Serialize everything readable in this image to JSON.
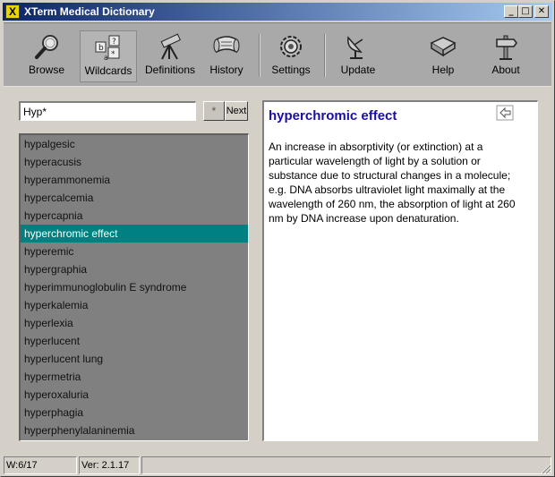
{
  "window": {
    "app_icon_letter": "X",
    "title": "XTerm Medical Dictionary",
    "controls": {
      "minimize": "_",
      "maximize": "□",
      "close": "✕"
    }
  },
  "toolbar": {
    "buttons": [
      {
        "label": "Browse",
        "icon": "magnifier-icon"
      },
      {
        "label": "Wildcards",
        "icon": "wildcards-icon"
      },
      {
        "label": "Definitions",
        "icon": "telescope-icon"
      },
      {
        "label": "History",
        "icon": "scroll-icon"
      },
      {
        "label": "Settings",
        "icon": "gear-icon"
      },
      {
        "label": "Update",
        "icon": "satellite-dish-icon"
      },
      {
        "label": "Help",
        "icon": "book-icon"
      },
      {
        "label": "About",
        "icon": "signpost-icon"
      }
    ]
  },
  "search": {
    "value": "Hyp*",
    "wildcard_label": "*",
    "next_label": "Next"
  },
  "word_list": {
    "items": [
      "hypalgesic",
      "hyperacusis",
      "hyperammonemia",
      "hypercalcemia",
      "hypercapnia",
      "hyperchromic effect",
      "hyperemic",
      "hypergraphia",
      "hyperimmunoglobulin E syndrome",
      "hyperkalemia",
      "hyperlexia",
      "hyperlucent",
      "hyperlucent lung",
      "hypermetria",
      "hyperoxaluria",
      "hyperphagia",
      "hyperphenylalaninemia"
    ],
    "selected_index": 5
  },
  "definition": {
    "term": "hyperchromic effect",
    "text": "An increase in absorptivity (or extinction) at a particular wavelength of light by a solution or substance due to structural changes in a molecule; e.g. DNA absorbs ultraviolet light maximally at the wavelength of 260 nm, the absorption of light at 260 nm by DNA increase upon denaturation."
  },
  "statusbar": {
    "word_count": "W:6/17",
    "version": "Ver: 2.1.17",
    "message": ""
  },
  "colors": {
    "title_start": "#0a246a",
    "title_end": "#a6caf0",
    "selection": "#008080",
    "term_color": "#1a0fa0",
    "list_bg": "#808080"
  }
}
